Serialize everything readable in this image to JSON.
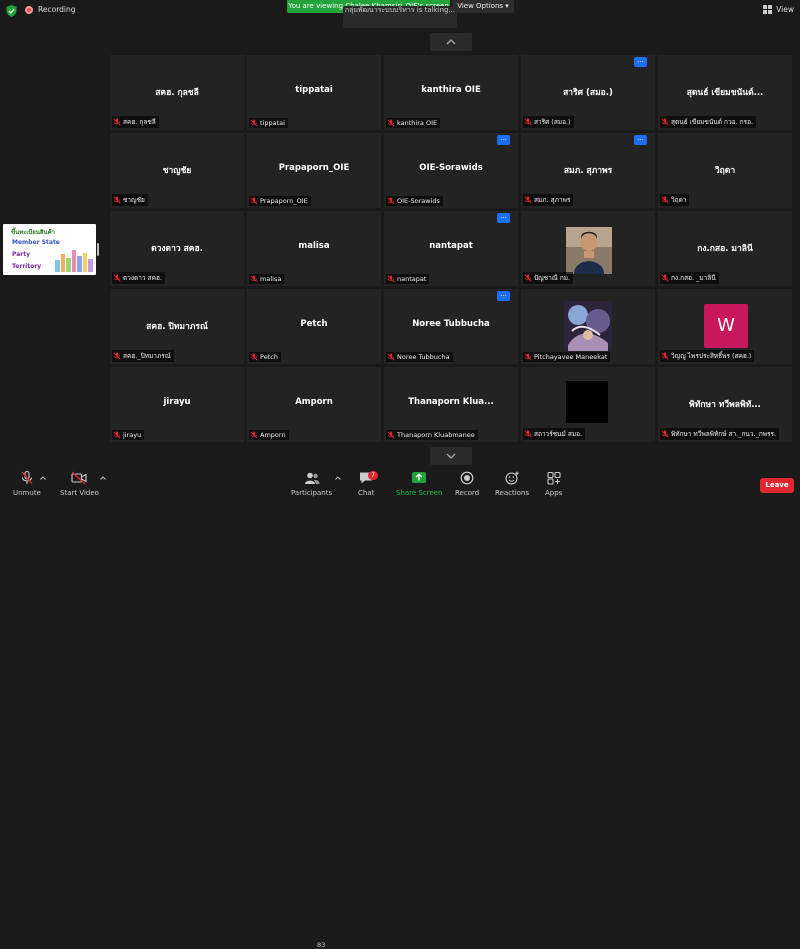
{
  "topbar": {
    "recording_label": "Recording",
    "viewing_banner": "You are viewing Chalee Khamsiri_OIE's screen",
    "view_options": "View Options",
    "speaking_text": "กลุ่มพัฒนาระบบบริหาร is talking...",
    "view_label": "View"
  },
  "thumbnail": {
    "heading": "ขึ้นทะเบียนสินค้า",
    "line1": "Member State",
    "line2": "Party",
    "line3": "Territory"
  },
  "tiles": [
    {
      "name": "สคฮ. กุลชลี",
      "label": "สคฮ. กุลชลี"
    },
    {
      "name": "tippatai",
      "label": "tippatai"
    },
    {
      "name": "kanthira OIE",
      "label": "kanthira OIE"
    },
    {
      "name": "สาริศ (สมอ.)",
      "label": "สาริศ (สมอ.)"
    },
    {
      "name": "สุดนธ์ เขียมขนันต์...",
      "label": "สุดนธ์ เขียมขนันต์ กวอ. กรอ."
    },
    {
      "name": "ชาญชัย",
      "label": "ชาญชัย"
    },
    {
      "name": "Prapaporn_OIE",
      "label": "Prapaporn_OIE"
    },
    {
      "name": "OIE-Sorawids",
      "label": "OIE-Sorawids"
    },
    {
      "name": "สมภ. สุภาพร",
      "label": "สมภ. สุภาพร"
    },
    {
      "name": "วิฤดา",
      "label": "วิฤดา"
    },
    {
      "name": "ดวงดาว สคฮ.",
      "label": "ดวงดาว สคฮ."
    },
    {
      "name": "malisa",
      "label": "malisa"
    },
    {
      "name": "nantapat",
      "label": "nantapat"
    },
    {
      "name": "",
      "label": "ปัญชาณี กม."
    },
    {
      "name": "กง.กสอ. มาลินี",
      "label": "กง.กสอ. _มาลินี"
    },
    {
      "name": "สคฮ. ปิทมาภรณ์",
      "label": "สคฮ._ปิทมาภรณ์"
    },
    {
      "name": "Petch",
      "label": "Petch"
    },
    {
      "name": "Noree Tubbucha",
      "label": "Noree Tubbucha"
    },
    {
      "name": "",
      "label": "Pitchayavee Maneekat"
    },
    {
      "name": "W",
      "label": "วิญญู ไพรประสิทธิ์พร (สคฮ.)"
    },
    {
      "name": "jirayu",
      "label": "jirayu"
    },
    {
      "name": "Amporn",
      "label": "Amporn"
    },
    {
      "name": "Thanaporn Klua...",
      "label": "Thanaporn Kluabmanee"
    },
    {
      "name": "",
      "label": "สถาวร์ชนม์ สมอ."
    },
    {
      "name": "พิทักษา ทวีพลพิทั...",
      "label": "พิทักษา ทวีพลพิทักษ์ สา._กนว._กพรร."
    }
  ],
  "toolbar": {
    "unmute": "Unmute",
    "start_video": "Start Video",
    "participants": "Participants",
    "participants_count": "83",
    "chat": "Chat",
    "chat_badge": "7",
    "share_screen": "Share Screen",
    "record": "Record",
    "reactions": "Reactions",
    "apps": "Apps",
    "leave": "Leave"
  },
  "colors": {
    "banner_green": "#22a33a",
    "more_blue": "#1e6ef0",
    "leave_red": "#e0262f",
    "muted_red": "#e0262f",
    "avatar_pink": "#c8175d"
  }
}
